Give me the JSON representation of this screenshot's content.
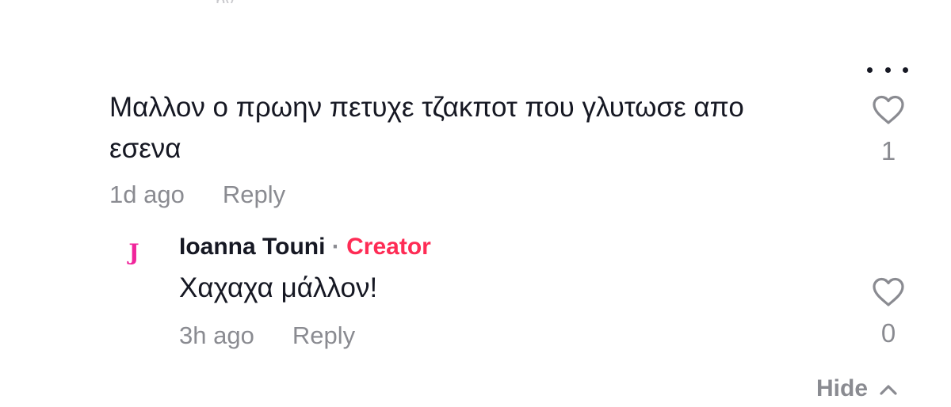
{
  "top_fragment": "py",
  "comment": {
    "text": "Μαλλον ο πρωην πετυχε τζακποτ που γλυτωσε απο εσενα",
    "time": "1d ago",
    "reply_label": "Reply",
    "like_count": "1"
  },
  "reply": {
    "avatar_letter": "J",
    "username": "Ioanna Touni",
    "separator": "·",
    "badge": "Creator",
    "text": "Χαχαχα μάλλον!",
    "time": "3h ago",
    "reply_label": "Reply",
    "like_count": "0"
  },
  "hide_label": "Hide",
  "colors": {
    "text": "#161823",
    "muted": "#8a8b91",
    "creator": "#fe2c55",
    "avatar": "#f0259b"
  },
  "icons": {
    "more": "more-horizontal-icon",
    "like": "heart-outline-icon",
    "collapse": "chevron-up-icon"
  }
}
